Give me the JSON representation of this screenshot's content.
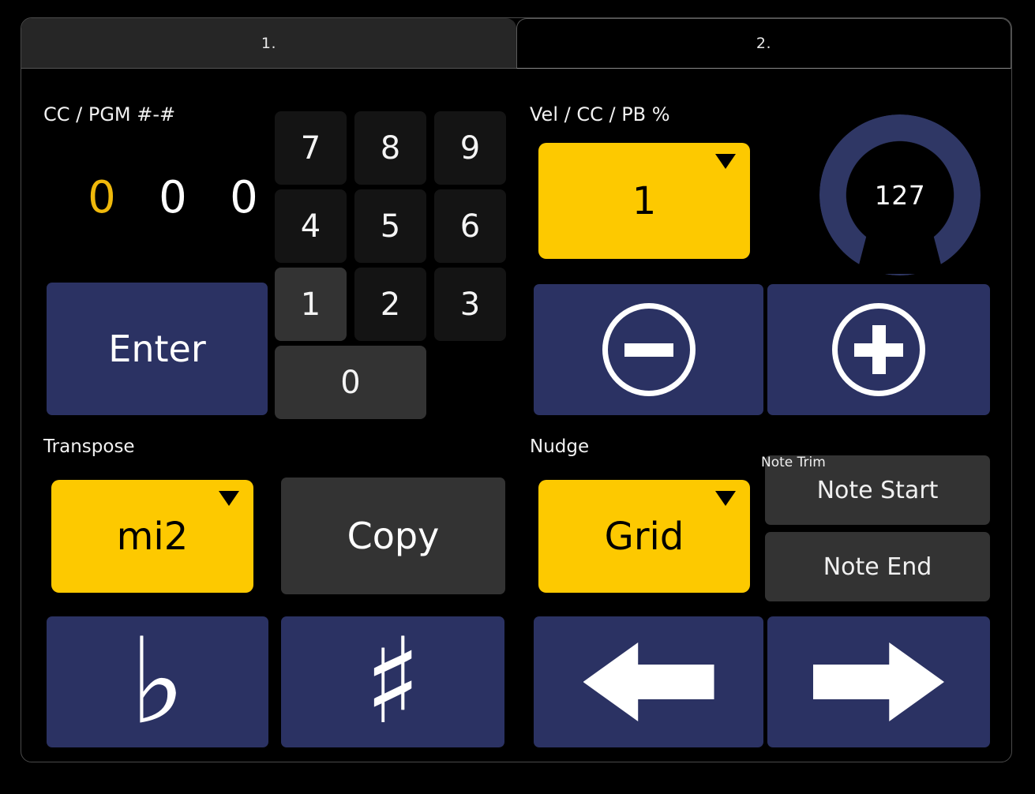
{
  "window": {
    "tabs": [
      {
        "label": "1.",
        "active": true
      },
      {
        "label": "2.",
        "active": false
      }
    ]
  },
  "left_panel": {
    "cc_pgm": {
      "label": "CC / PGM #-#",
      "digits": [
        {
          "value": "0",
          "color": "#f0b90b",
          "highlighted": true
        },
        {
          "value": "0",
          "color": "#ffffff",
          "highlighted": false
        },
        {
          "value": "0",
          "color": "#ffffff",
          "highlighted": false
        }
      ]
    },
    "numpad": {
      "keys": [
        {
          "label": "7",
          "state": "dark"
        },
        {
          "label": "8",
          "state": "dark"
        },
        {
          "label": "9",
          "state": "dark"
        },
        {
          "label": "4",
          "state": "dark"
        },
        {
          "label": "5",
          "state": "dark"
        },
        {
          "label": "6",
          "state": "dark"
        },
        {
          "label": "1",
          "state": "lit"
        },
        {
          "label": "2",
          "state": "dark"
        },
        {
          "label": "3",
          "state": "dark"
        }
      ],
      "zero_key": {
        "label": "0",
        "state": "lit"
      }
    },
    "enter_button": {
      "label": "Enter",
      "color": "#2b3263"
    },
    "transpose": {
      "label": "Transpose",
      "interval_dropdown": {
        "value": "mi2",
        "color": "#fdc900"
      },
      "copy_button": {
        "label": "Copy",
        "color": "#333333"
      },
      "flat_button": {
        "glyph": "♭",
        "icon": "flat-icon",
        "color": "#2b3263"
      },
      "sharp_button": {
        "glyph": "♯",
        "icon": "sharp-icon",
        "color": "#2b3263"
      }
    }
  },
  "right_panel": {
    "vel_cc_pb": {
      "label": "Vel / CC / PB %",
      "target_dropdown": {
        "value": "1",
        "color": "#fdc900"
      },
      "knob": {
        "value": "127",
        "color": "#2f3765"
      },
      "decrement_button": {
        "icon": "minus-circle-icon",
        "color": "#2b3263"
      },
      "increment_button": {
        "icon": "plus-circle-icon",
        "color": "#2b3263"
      }
    },
    "nudge": {
      "label": "Nudge",
      "resolution_dropdown": {
        "value": "Grid",
        "color": "#fdc900"
      },
      "nudge_left_button": {
        "icon": "arrow-left-icon",
        "color": "#2b3263"
      },
      "nudge_right_button": {
        "icon": "arrow-right-icon",
        "color": "#2b3263"
      }
    },
    "note_trim": {
      "label": "Note Trim",
      "note_start_button": {
        "label": "Note Start",
        "color": "#333333"
      },
      "note_end_button": {
        "label": "Note End",
        "color": "#333333"
      }
    }
  }
}
